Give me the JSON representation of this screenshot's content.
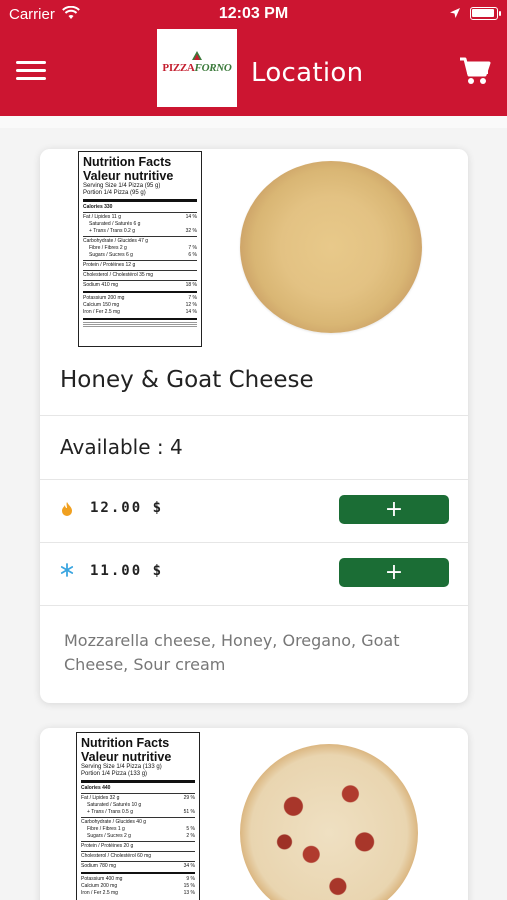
{
  "status_bar": {
    "carrier": "Carrier",
    "time": "12:03 PM"
  },
  "header": {
    "title": "Location",
    "logo": {
      "text_a": "PIZZA",
      "text_b": "FORNO"
    }
  },
  "products": [
    {
      "name": "Honey & Goat Cheese",
      "available": "Available : 4",
      "prices": [
        {
          "icon": "flame-icon",
          "icon_color": "#f0a020",
          "value": "12.00  $",
          "button": "+"
        },
        {
          "icon": "snowflake-icon",
          "icon_color": "#3aa5e0",
          "value": "11.00  $",
          "button": "+"
        }
      ],
      "description": "Mozzarella cheese, Honey, Oregano, Goat Cheese, Sour cream",
      "nutrition": {
        "title_en": "Nutrition Facts",
        "title_fr": "Valeur nutritive",
        "serving": "Serving Size 1/4 Pizza (95 g)",
        "portion": "Portion 1/4 Pizza (95 g)",
        "calories": "Calories 330",
        "rows": [
          [
            "Fat / Lipides 11 g",
            "14 %"
          ],
          [
            "Saturated / Saturés 6 g",
            ""
          ],
          [
            "+ Trans / Trans 0.2 g",
            "32 %"
          ],
          [
            "Carbohydrate / Glucides 47 g",
            ""
          ],
          [
            "Fibre / Fibres 2 g",
            "7 %"
          ],
          [
            "Sugars / Sucres 6 g",
            "6 %"
          ],
          [
            "Protein / Protéines 12 g",
            ""
          ],
          [
            "Cholesterol / Cholestérol 35 mg",
            ""
          ],
          [
            "Sodium 410 mg",
            "18 %"
          ],
          [
            "Potassium 200 mg",
            "7 %"
          ],
          [
            "Calcium 150 mg",
            "12 %"
          ],
          [
            "Iron / Fer 2.5 mg",
            "14 %"
          ]
        ]
      }
    },
    {
      "nutrition": {
        "title_en": "Nutrition Facts",
        "title_fr": "Valeur nutritive",
        "serving": "Serving Size 1/4 Pizza (133 g)",
        "portion": "Portion 1/4 Pizza (133 g)",
        "calories": "Calories 440",
        "rows": [
          [
            "Fat / Lipides 32 g",
            "29 %"
          ],
          [
            "Saturated / Saturés 10 g",
            ""
          ],
          [
            "+ Trans / Trans 0.5 g",
            "51 %"
          ],
          [
            "Carbohydrate / Glucides 40 g",
            ""
          ],
          [
            "Fibre / Fibres 1 g",
            "5 %"
          ],
          [
            "Sugars / Sucres 2 g",
            "2 %"
          ],
          [
            "Protein / Protéines 20 g",
            ""
          ],
          [
            "Cholesterol / Cholestérol 60 mg",
            ""
          ],
          [
            "Sodium 780 mg",
            "34 %"
          ],
          [
            "Potassium 400 mg",
            "9 %"
          ],
          [
            "Calcium 200 mg",
            "15 %"
          ],
          [
            "Iron / Fer 2.5 mg",
            "13 %"
          ]
        ]
      }
    }
  ],
  "colors": {
    "brand_red": "#cc1531",
    "button_green": "#1b6d35"
  }
}
